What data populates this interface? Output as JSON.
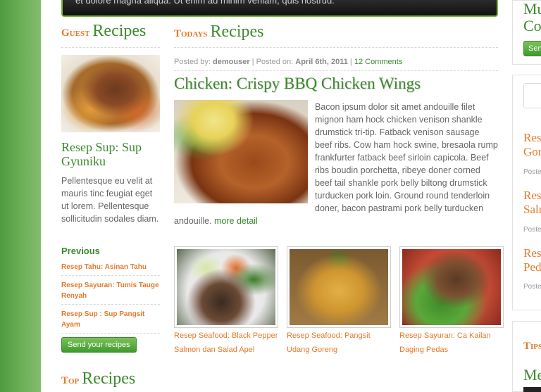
{
  "slider": {
    "text": "et dolore magna aliqua. Ut enim ad minim veniam, quis nostrud."
  },
  "guest": {
    "title_small": "Guest",
    "title_big": "Recipes",
    "recipe_title": "Resep Sup: Sup Gyuniku",
    "description": "Pellentesque eu velit at mauris tinc feugiat eget ut lorem. Pellentesque sollicitudin sodales diam.",
    "previous_label": "Previous",
    "previous_items": [
      "Resep Tahu: Asinan Tahu",
      "Resep Sayuran: Tumis Tauge Renyah",
      "Resep Sup : Sup Pangsit Ayam"
    ],
    "send_button": "Send your recipes"
  },
  "top": {
    "title_small": "Top",
    "title_big": "Recipes"
  },
  "todays": {
    "title_small": "Todays",
    "title_big": "Recipes",
    "meta": {
      "posted_by_label": "Posted by:",
      "author": "demouser",
      "posted_on_label": "| Posted on:",
      "date": "April 6th, 2011",
      "separator": "|",
      "comments": "12 Comments"
    },
    "post_title": "Chicken: Crispy BBQ Chicken Wings",
    "post_body": "Bacon ipsum dolor sit amet andouille filet mignon ham hock chicken venison shankle drumstick tri-tip. Fatback venison sausage beef ribs. Cow ham hock swine, bresaola rump frankfurter fatback beef sirloin capicola. Beef ribs boudin porchetta, ribeye doner corned beef tail shankle pork belly biltong drumstick turducken pork loin. Ground round tenderloin doner, bacon pastrami pork belly turducken andouille.",
    "more_link": "more detail",
    "thumbnails": [
      {
        "caption": "Resep Seafood: Black Pepper Salmon dan Salad Apel"
      },
      {
        "caption": "Resep Seafood: Pangsit Udang Goreng"
      },
      {
        "caption": "Resep Sayuran: Ca Kailan Daging Pedas"
      }
    ]
  },
  "right": {
    "heading1": "Mu",
    "heading2": "Co",
    "button": "Sen",
    "items": [
      {
        "line1": "Res",
        "line2": "Gor",
        "meta": "Poste"
      },
      {
        "line1": "Res",
        "line2": "Salr",
        "meta": "Poste"
      },
      {
        "line1": "Res",
        "line2": "Ped",
        "meta": "Poste"
      }
    ],
    "tips": "Tips",
    "bottom": "Me"
  }
}
